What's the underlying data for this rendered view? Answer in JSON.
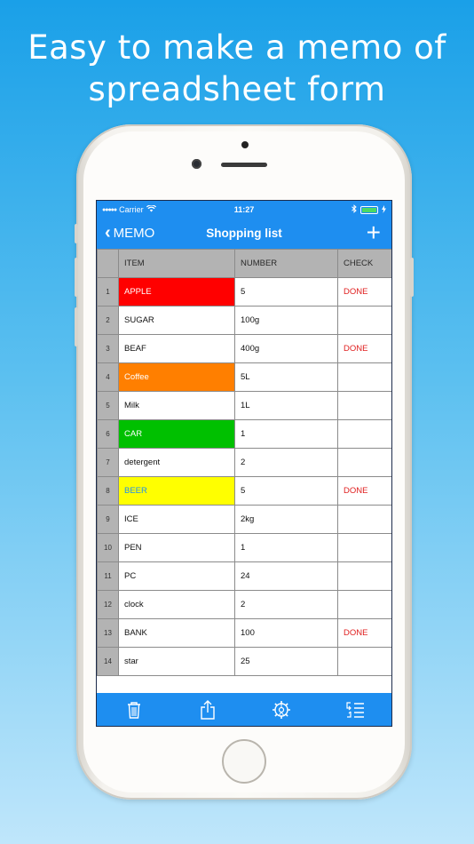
{
  "headline": {
    "line1": "Easy to make a memo of",
    "line2": "spreadsheet form"
  },
  "status": {
    "carrier": "Carrier",
    "time": "11:27"
  },
  "nav": {
    "back_label": "MEMO",
    "title": "Shopping list",
    "add_label": "+"
  },
  "sheet": {
    "columns": [
      "ITEM",
      "NUMBER",
      "CHECK"
    ],
    "rows": [
      {
        "num": "1",
        "item": "APPLE",
        "number": "5",
        "check": "DONE",
        "bg": "#ff0000",
        "fg": "#ffffff"
      },
      {
        "num": "2",
        "item": "SUGAR",
        "number": "100g",
        "check": "",
        "bg": "",
        "fg": ""
      },
      {
        "num": "3",
        "item": "BEAF",
        "number": "400g",
        "check": "DONE",
        "bg": "",
        "fg": ""
      },
      {
        "num": "4",
        "item": "Coffee",
        "number": "5L",
        "check": "",
        "bg": "#ff7f00",
        "fg": "#ffffff"
      },
      {
        "num": "5",
        "item": "Milk",
        "number": "1L",
        "check": "",
        "bg": "",
        "fg": ""
      },
      {
        "num": "6",
        "item": "CAR",
        "number": "1",
        "check": "",
        "bg": "#00c000",
        "fg": "#ffffff"
      },
      {
        "num": "7",
        "item": "detergent",
        "number": "2",
        "check": "",
        "bg": "",
        "fg": ""
      },
      {
        "num": "8",
        "item": "BEER",
        "number": "5",
        "check": "DONE",
        "bg": "#ffff00",
        "fg": "#1e8ef0"
      },
      {
        "num": "9",
        "item": "ICE",
        "number": "2kg",
        "check": "",
        "bg": "",
        "fg": ""
      },
      {
        "num": "10",
        "item": "PEN",
        "number": "1",
        "check": "",
        "bg": "",
        "fg": ""
      },
      {
        "num": "11",
        "item": "PC",
        "number": "24",
        "check": "",
        "bg": "",
        "fg": ""
      },
      {
        "num": "12",
        "item": "clock",
        "number": "2",
        "check": "",
        "bg": "",
        "fg": ""
      },
      {
        "num": "13",
        "item": "BANK",
        "number": "100",
        "check": "DONE",
        "bg": "",
        "fg": ""
      },
      {
        "num": "14",
        "item": "star",
        "number": "25",
        "check": "",
        "bg": "",
        "fg": ""
      }
    ]
  },
  "toolbar": {
    "icons": [
      "trash-icon",
      "share-icon",
      "settings-gear-icon",
      "sort-list-icon"
    ]
  },
  "colors": {
    "accent": "#1e8ef0",
    "done": "#e02020",
    "header_gray": "#b3b3b3"
  }
}
